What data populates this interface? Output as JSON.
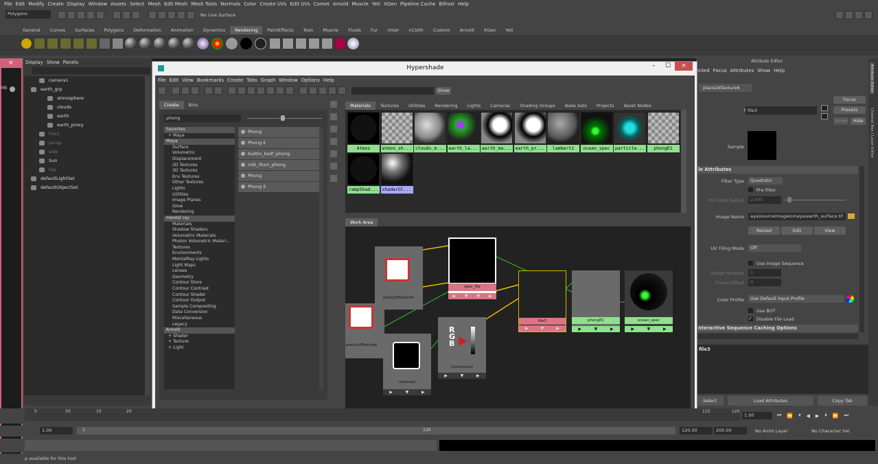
{
  "menubar": {
    "items": [
      "File",
      "Edit",
      "Modify",
      "Create",
      "Display",
      "Window",
      "Assets",
      "Select",
      "Mesh",
      "Edit Mesh",
      "Mesh Tools",
      "Normals",
      "Color",
      "Create UVs",
      "Edit UVs",
      "Comet",
      "Arnold",
      "Muscle",
      "Yeti",
      "XGen",
      "Pipeline Cache",
      "Bifrost",
      "Help"
    ]
  },
  "statusline": {
    "menuset": "Polygons",
    "live_surface": "No Live Surface"
  },
  "shelf": {
    "tabs": [
      "General",
      "Curves",
      "Surfaces",
      "Polygons",
      "Deformation",
      "Animation",
      "Dynamics",
      "Rendering",
      "PaintEffects",
      "Toon",
      "Muscle",
      "Fluids",
      "Fur",
      "nHair",
      "nCloth",
      "Custom",
      "Arnold",
      "XGen",
      "Yeti"
    ],
    "active_tab": "Rendering"
  },
  "outliner": {
    "menu": [
      "Display",
      "Show",
      "Panels"
    ],
    "items": [
      "camera1",
      "earth_grp",
      "atmosphere",
      "clouds",
      "earth",
      "earth_proxy",
      "front",
      "persp",
      "side",
      "Sun",
      "top",
      "defaultLightSet",
      "defaultObjectSet"
    ]
  },
  "left_strip": {
    "mb": "MB"
  },
  "hypershade": {
    "title": "Hypershade",
    "menu": [
      "File",
      "Edit",
      "View",
      "Bookmarks",
      "Create",
      "Tabs",
      "Graph",
      "Window",
      "Options",
      "Help"
    ],
    "show_button": "Show",
    "create_tabs": [
      "Create",
      "Bins"
    ],
    "search_value": "phong",
    "tree": [
      {
        "text": "Favorites",
        "hd": true
      },
      {
        "text": "+ Maya",
        "sub": true
      },
      {
        "text": "Maya",
        "hd": true
      },
      {
        "text": "Surface"
      },
      {
        "text": "Volumetric"
      },
      {
        "text": "Displacement"
      },
      {
        "text": "2D Textures"
      },
      {
        "text": "3D Textures"
      },
      {
        "text": "Env Textures"
      },
      {
        "text": "Other Textures"
      },
      {
        "text": "Lights"
      },
      {
        "text": "Utilities"
      },
      {
        "text": "Image Planes"
      },
      {
        "text": "Glow"
      },
      {
        "text": "Rendering"
      },
      {
        "text": "mental ray",
        "hd": true
      },
      {
        "text": "Materials"
      },
      {
        "text": "Shadow Shaders"
      },
      {
        "text": "Volumetric Materials"
      },
      {
        "text": "Photon Volumetric Materi..."
      },
      {
        "text": "Textures"
      },
      {
        "text": "Environments"
      },
      {
        "text": "MentalRay Lights"
      },
      {
        "text": "Light Maps"
      },
      {
        "text": "Lenses"
      },
      {
        "text": "Geometry"
      },
      {
        "text": "Contour Store"
      },
      {
        "text": "Contour Contrast"
      },
      {
        "text": "Contour Shader"
      },
      {
        "text": "Contour Output"
      },
      {
        "text": "Sample Compositing"
      },
      {
        "text": "Data Conversion"
      },
      {
        "text": "Miscellaneous"
      },
      {
        "text": "Legacy"
      },
      {
        "text": "Arnold",
        "hd": true
      },
      {
        "text": "+ Shader",
        "sub": true
      },
      {
        "text": "+ Texture",
        "sub": true
      },
      {
        "text": "+ Light",
        "sub": true
      }
    ],
    "results": [
      "Phong",
      "Phong E",
      "builtin_bsdf_phong",
      "mib_illum_phong",
      "Phong",
      "Phong E"
    ],
    "browser_tabs": [
      "Materials",
      "Textures",
      "Utilities",
      "Rendering",
      "Lights",
      "Cameras",
      "Shading Groups",
      "Bake Sets",
      "Projects",
      "Asset Nodes"
    ],
    "swatches": [
      {
        "name": "Atmos",
        "style": "dark",
        "color": "#8fe08f"
      },
      {
        "name": "atmos_sh...",
        "style": "checker",
        "color": "#8fe08f"
      },
      {
        "name": "clouds_m...",
        "style": "clouds",
        "color": "#8fe08f"
      },
      {
        "name": "earth_la...",
        "style": "purple",
        "color": "#8fe08f"
      },
      {
        "name": "earth_ma...",
        "style": "bw",
        "color": "#8fe08f"
      },
      {
        "name": "earth_pr...",
        "style": "bw",
        "color": "#8fe08f"
      },
      {
        "name": "lambert1",
        "style": "grey",
        "color": "#8fe08f"
      },
      {
        "name": "ocean_spec",
        "style": "green",
        "color": "#8fe08f"
      },
      {
        "name": "particle...",
        "style": "teal",
        "color": "#8fe08f"
      },
      {
        "name": "phongE1",
        "style": "checkerdark",
        "color": "#8fe08f"
      },
      {
        "name": "rampShad...",
        "style": "dark",
        "color": "#8fe08f"
      },
      {
        "name": "shaderGl...",
        "style": "glossy",
        "color": "#a9a9ff"
      }
    ],
    "workarea_tab": "Work Area",
    "nodes": {
      "place2d_a": "place2dTexture5",
      "place2d_b": "place2dTexture6",
      "spec_file": "spec_file",
      "file3": "file3",
      "phongE1": "phongE1",
      "ocean_spec": "ocean_spec",
      "reverse": "reverse2",
      "luminance": "luminance2"
    },
    "rgb_text": "RGB"
  },
  "attribute_editor": {
    "header": "Attribute Editor",
    "menu": [
      "ected",
      "Focus",
      "Attributes",
      "Show",
      "Help"
    ],
    "node_tab": "place2dTexture6",
    "file_label": "file:",
    "file_value": "file3",
    "buttons_right": [
      "Focus",
      "Presets",
      "Show",
      "Hide"
    ],
    "sample_label": "Sample",
    "section1": "le Attributes",
    "filter_type_label": "Filter Type",
    "filter_type_value": "Quadratic",
    "pre_filter_label": "Pre Filter",
    "pre_filter_radius_label": "Pre Filter Radius",
    "pre_filter_radius_value": "2.000",
    "image_name_label": "Image Name",
    "image_name_value": "aya\\sourceimages\\maya\\earth_surface.tif",
    "reload": "Reload",
    "edit": "Edit",
    "view": "View",
    "uv_tiling_label": "UV Tiling Mode",
    "uv_tiling_value": "Off",
    "use_image_sequence": "Use Image Sequence",
    "image_number_label": "Image Number",
    "image_number_value": "1",
    "frame_offset_label": "Frame Offset",
    "frame_offset_value": "0",
    "color_profile_label": "Color Profile",
    "color_profile_value": "Use Default Input Profile",
    "use_bot": "Use BOT",
    "disable_file_load": "Disable File Load",
    "section2": "nteractive Sequence Caching Options",
    "file3_label": "file3",
    "bottom_buttons": [
      "Select",
      "Load Attributes",
      "Copy Tab"
    ],
    "side_tabs": [
      "Attribute Editor",
      "Channel Box / Layer Editor"
    ]
  },
  "timeline": {
    "ticks": [
      "5",
      "10",
      "15",
      "20",
      "115",
      "120"
    ],
    "current": "1.00"
  },
  "range": {
    "start": "1.00",
    "inner_start": "1",
    "inner_end": "120",
    "end": "120.00",
    "end2": "200.00",
    "anim_layer": "No Anim Layer",
    "char_set": "No Character Set"
  },
  "helpline": {
    "text": "p available for this tool"
  }
}
